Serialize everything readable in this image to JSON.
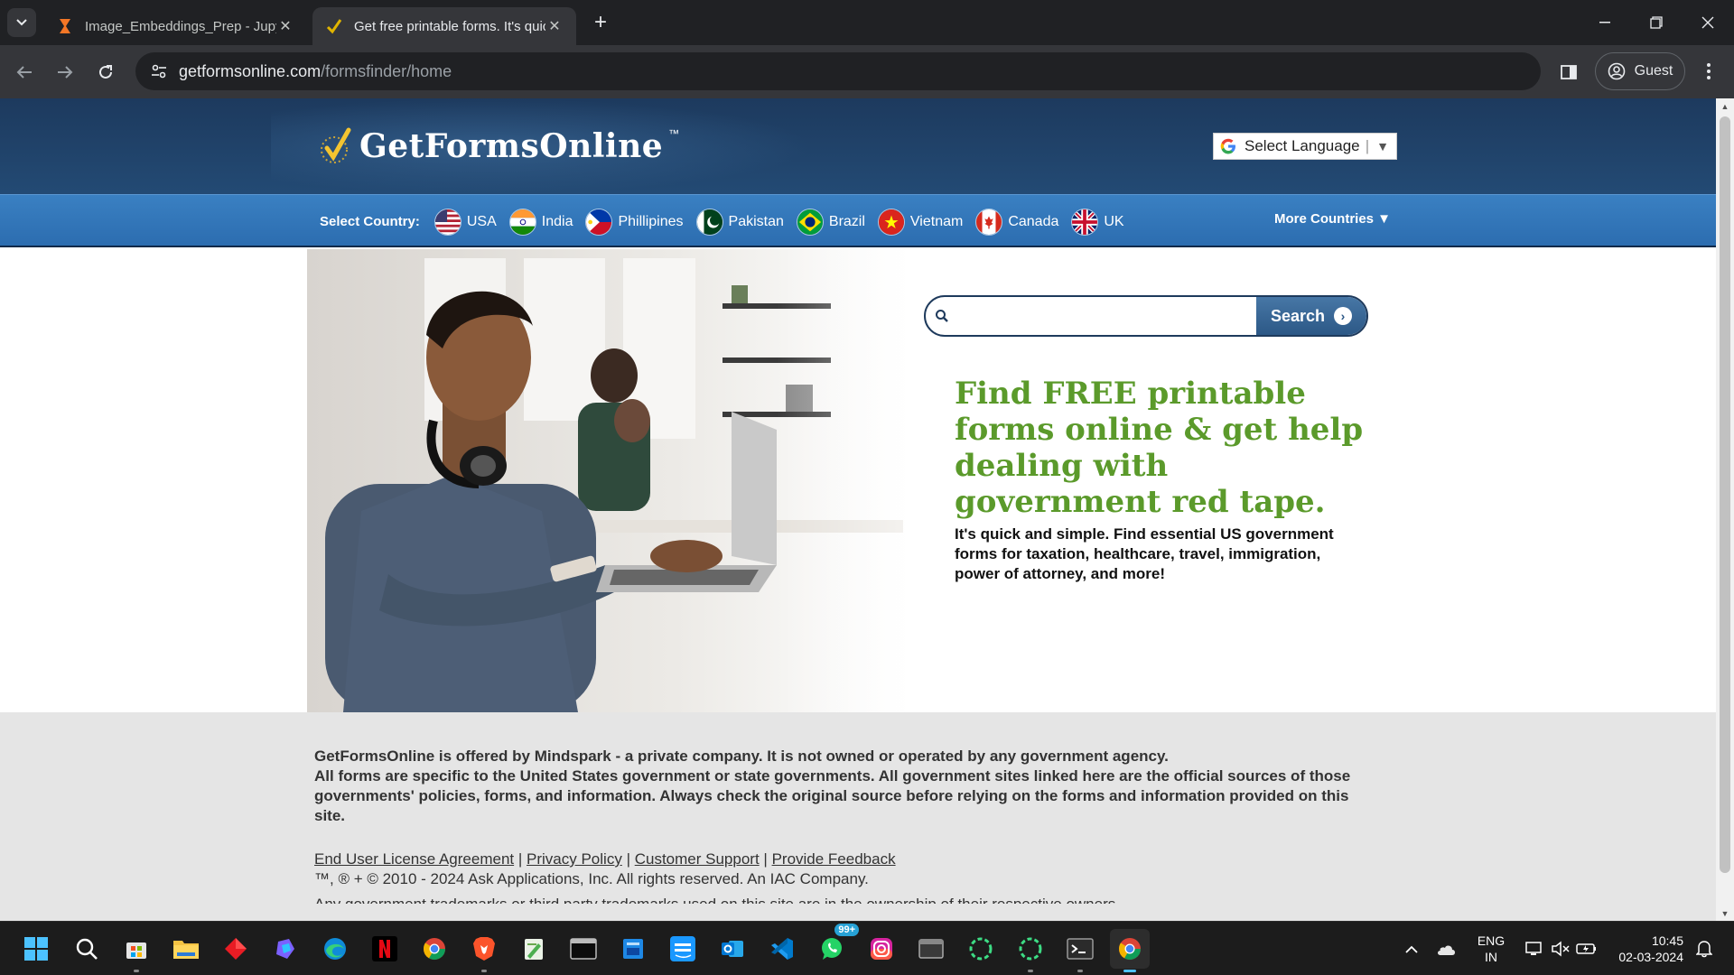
{
  "browser": {
    "tabs": [
      {
        "title": "Image_Embeddings_Prep - Jupyter",
        "favicon": "hourglass-icon",
        "active": false
      },
      {
        "title": "Get free printable forms. It's quick",
        "favicon": "checkmark-icon",
        "active": true
      }
    ],
    "url_host": "getformsonline.com",
    "url_path": "/formsfinder/home",
    "profile_label": "Guest"
  },
  "site": {
    "logo_text": "GetFormsOnline",
    "logo_tm": "™",
    "language_select": "Select Language",
    "country_label": "Select Country:",
    "countries": [
      {
        "name": "USA",
        "flag": "us-flag-icon"
      },
      {
        "name": "India",
        "flag": "india-flag-icon"
      },
      {
        "name": "Phillipines",
        "flag": "philippines-flag-icon"
      },
      {
        "name": "Pakistan",
        "flag": "pakistan-flag-icon"
      },
      {
        "name": "Brazil",
        "flag": "brazil-flag-icon"
      },
      {
        "name": "Vietnam",
        "flag": "vietnam-flag-icon"
      },
      {
        "name": "Canada",
        "flag": "canada-flag-icon"
      },
      {
        "name": "UK",
        "flag": "uk-flag-icon"
      }
    ],
    "more_countries": "More Countries ▼",
    "search": {
      "placeholder": "",
      "button": "Search"
    },
    "headline": "Find FREE printable forms online & get help dealing with government red tape.",
    "subtext": "It's quick and simple. Find essential US government forms for taxation, healthcare, travel, immigration, power of attorney, and more!"
  },
  "footer": {
    "disclaimer_bold": "GetFormsOnline is offered by Mindspark - a private company. It is not owned or operated by any government agency.",
    "disclaimer": "All forms are specific to the United States government or state governments. All government sites linked here are the official sources of those governments' policies, forms, and information. Always check the original source before relying on the forms and information provided on this site.",
    "links": [
      "End User License Agreement",
      "Privacy Policy",
      "Customer Support",
      "Provide Feedback"
    ],
    "separator": "|",
    "copyright": "™, ® + © 2010 - 2024 Ask Applications, Inc. All rights reserved. An IAC Company.",
    "cutoff_text": "Any government trademarks or third party trademarks used on this site are in the ownership of their respective owners."
  },
  "taskbar": {
    "apps": [
      "start-icon",
      "search-icon",
      "microsoft-store-icon",
      "file-explorer-icon",
      "app-red-icon",
      "copilot-icon",
      "edge-icon",
      "netflix-icon",
      "chrome-icon",
      "brave-icon",
      "notepad-icon",
      "terminal-icon",
      "app-blue-icon",
      "prime-video-icon",
      "outlook-icon",
      "vscode-icon",
      "whatsapp-icon",
      "instagram-icon",
      "app-window-icon",
      "loading-app-icon",
      "loading-app-2-icon",
      "terminal-2-icon",
      "chrome-active-icon"
    ],
    "whatsapp_badge": "99+",
    "language_line1": "ENG",
    "language_line2": "IN",
    "time": "10:45",
    "date": "02-03-2024"
  }
}
